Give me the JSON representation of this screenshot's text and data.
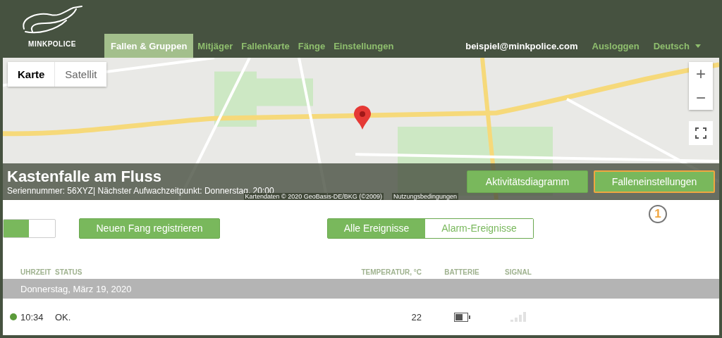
{
  "header": {
    "logo_text": "MINKPOLICE",
    "nav": [
      {
        "label": "Fallen & Gruppen",
        "selected": true
      },
      {
        "label": "Mitjäger",
        "selected": false
      },
      {
        "label": "Fallenkarte",
        "selected": false
      },
      {
        "label": "Fänge",
        "selected": false
      },
      {
        "label": "Einstellungen",
        "selected": false
      }
    ],
    "user_email": "beispiel@minkpolice.com",
    "logout": "Ausloggen",
    "language": "Deutsch"
  },
  "map": {
    "map_types": [
      {
        "label": "Karte",
        "selected": true
      },
      {
        "label": "Satellit",
        "selected": false
      }
    ],
    "zoom_in": "+",
    "zoom_out": "−",
    "attribution": [
      "Kartendaten © 2020 GeoBasis-DE/BKG (©2009)",
      "Nutzungsbedingungen"
    ]
  },
  "trap": {
    "title": "Kastenfalle am Fluss",
    "subtitle": "Seriennummer: 56XYZ| Nächster Aufwachzeitpunkt: Donnerstag, 20:00",
    "buttons": [
      {
        "label": "Aktivitätsdiagramm",
        "highlighted": false
      },
      {
        "label": "Falleneinstellungen",
        "highlighted": true
      }
    ],
    "callout": "1"
  },
  "toolbar": {
    "toggle": {
      "on": true
    },
    "register_button": "Neuen Fang registrieren",
    "filters": [
      {
        "label": "Alle Ereignisse",
        "selected": true
      },
      {
        "label": "Alarm-Ereignisse",
        "selected": false
      }
    ]
  },
  "table": {
    "columns": [
      "UHRZEIT",
      "STATUS",
      "TEMPERATUR, °C",
      "BATTERIE",
      "SIGNAL"
    ],
    "groups": [
      {
        "date": "Donnerstag, März 19, 2020",
        "rows": [
          {
            "color": "#5b9a3a",
            "time": "10:34",
            "status": "OK.",
            "temperature": "22",
            "battery": {
              "level": 0.67
            }
          }
        ]
      }
    ]
  }
}
